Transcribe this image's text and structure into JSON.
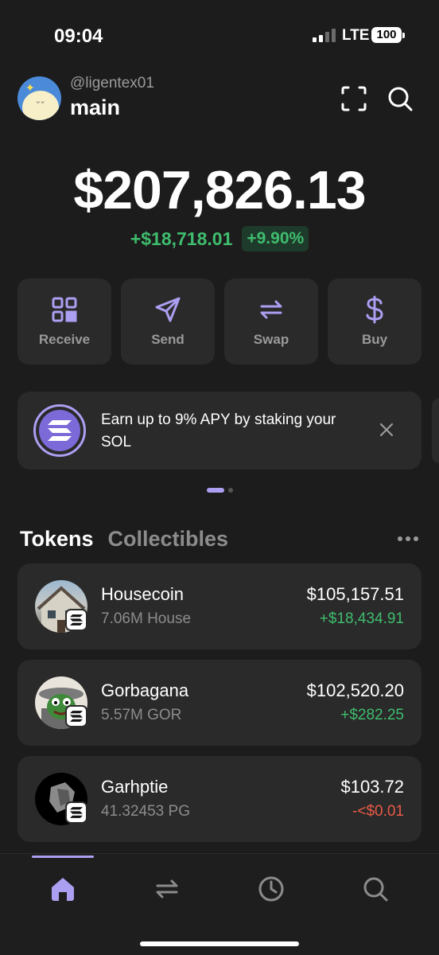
{
  "status": {
    "time": "09:04",
    "network": "LTE",
    "battery": "100"
  },
  "header": {
    "handle": "@ligentex01",
    "account_name": "main"
  },
  "portfolio": {
    "balance": "$207,826.13",
    "change_abs": "+$18,718.01",
    "change_pct": "+9.90%"
  },
  "actions": [
    {
      "label": "Receive",
      "icon": "qr-code-icon"
    },
    {
      "label": "Send",
      "icon": "send-icon"
    },
    {
      "label": "Swap",
      "icon": "swap-icon"
    },
    {
      "label": "Buy",
      "icon": "dollar-icon"
    }
  ],
  "banner": {
    "text": "Earn up to 9% APY by staking your SOL",
    "icon": "solana-icon"
  },
  "tabs": {
    "tokens": "Tokens",
    "collectibles": "Collectibles"
  },
  "tokens": [
    {
      "name": "Housecoin",
      "amount": "7.06M House",
      "value": "$105,157.51",
      "change": "+$18,434.91"
    },
    {
      "name": "Gorbagana",
      "amount": "5.57M GOR",
      "value": "$102,520.20",
      "change": "+$282.25"
    },
    {
      "name": "Garhptie",
      "amount": "41.32453 PG",
      "value": "$103.72",
      "change": "-<$0.01"
    }
  ],
  "colors": {
    "accent": "#ab9ff2",
    "positive": "#3fbd6e",
    "negative": "#eb5a46",
    "card": "#2a2a2a",
    "background": "#1c1c1c"
  },
  "nav": [
    "home-icon",
    "swap-icon",
    "history-icon",
    "search-icon"
  ]
}
